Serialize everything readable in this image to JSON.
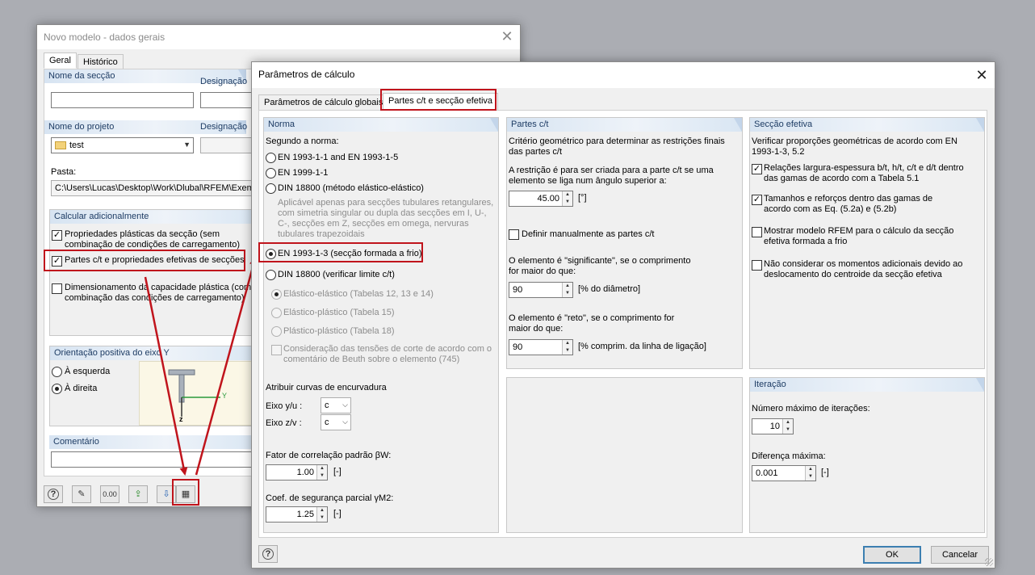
{
  "back_window": {
    "title": "Novo modelo - dados gerais",
    "tabs": [
      "Geral",
      "Histórico"
    ],
    "section_name_label": "Nome da secção",
    "designation_label": "Designação",
    "section_name_value": "",
    "project_name_label": "Nome do projeto",
    "project_designation_label": "Designação",
    "project_value": "test",
    "folder_label": "Pasta:",
    "folder_value": "C:\\Users\\Lucas\\Desktop\\Work\\Dlubal\\RFEM\\Exemp",
    "calc_group_title": "Calcular adicionalmente",
    "calc_options": [
      {
        "label": "Propriedades plásticas da secção (sem combinação de condições de carregamento)",
        "checked": true
      },
      {
        "label": "Partes c/t e propriedades efetivas de secções",
        "checked": true
      },
      {
        "label": "Dimensionamento da capacidade plástica (com combinação das condições de carregamento)",
        "checked": false
      }
    ],
    "axis_group_title": "Orientação positiva do eixo Y",
    "axis_options": [
      {
        "label": "À esquerda",
        "selected": false
      },
      {
        "label": "À direita",
        "selected": true
      }
    ],
    "axis_y": "Y",
    "axis_z": "z",
    "comment_label": "Comentário",
    "toolbar_icons": [
      "help-icon",
      "edit-icon",
      "units-icon",
      "export-icon",
      "import-icon",
      "settings-icon"
    ],
    "units_text": "0.00"
  },
  "dialog": {
    "title": "Parâmetros de cálculo",
    "tabs": [
      "Parâmetros de cálculo globais",
      "Partes c/t e secção efetiva"
    ],
    "norma": {
      "title": "Norma",
      "according_label": "Segundo a norma:",
      "options": [
        {
          "label": "EN 1993-1-1 and EN 1993-1-5",
          "selected": false
        },
        {
          "label": "EN 1999-1-1",
          "selected": false
        },
        {
          "label": "DIN 18800 (método elástico-elástico)",
          "selected": false
        },
        {
          "label": "EN 1993-1-3 (secção formada a frio)",
          "selected": true
        },
        {
          "label": "DIN 18800 (verificar limite c/t)",
          "selected": false
        }
      ],
      "din_note": "Aplicável apenas para secções tubulares retangulares, com simetria singular ou dupla das secções em I, U-, C-, secções em Z, secções em omega, nervuras tubulares trapezoidais",
      "sub_options": [
        "Elástico-elástico (Tabelas 12, 13 e 14)",
        "Elástico-plástico  (Tabela 15)",
        "Plástico-plástico  (Tabela 18)"
      ],
      "shear_label": "Consideração das tensões de corte de acordo com o comentário de Beuth sobre o elemento (745)",
      "curves_label": "Atribuir curvas de encurvadura",
      "axis_yu_label": "Eixo y/u :",
      "axis_yu_value": "c",
      "axis_zv_label": "Eixo z/v :",
      "axis_zv_value": "c",
      "corr_label": "Fator de correlação padrão βW:",
      "corr_value": "1.00",
      "corr_unit": "[-]",
      "gamma_label": "Coef. de segurança parcial γM2:",
      "gamma_value": "1.25",
      "gamma_unit": "[-]"
    },
    "ct": {
      "title": "Partes c/t",
      "desc": "Critério geométrico para determinar as restrições finais das partes c/t",
      "restriction_label": "A restrição é para ser criada para a parte c/t se uma elemento se liga num ângulo superior a:",
      "angle_value": "45.00",
      "angle_unit": "[°]",
      "manual_label": "Definir manualmente as partes c/t",
      "significant_label": "O elemento é \"significante\", se o comprimento for maior do que:",
      "significant_value": "90",
      "significant_unit": "[% do diâmetro]",
      "straight_label": "O elemento é \"reto\", se o comprimento for maior do que:",
      "straight_value": "90",
      "straight_unit": "[% comprim. da linha de ligação]"
    },
    "effective": {
      "title": "Secção efetiva",
      "desc": "Verificar proporções geométricas de acordo com EN 1993-1-3, 5.2",
      "options": [
        {
          "label": "Relações largura-espessura b/t, h/t, c/t e d/t dentro das gamas de acordo com a Tabela 5.1",
          "checked": true
        },
        {
          "label": "Tamanhos e reforços dentro das gamas de acordo com as Eq. (5.2a) e (5.2b)",
          "checked": true
        },
        {
          "label": "Mostrar modelo RFEM para o cálculo da secção efetiva formada a frio",
          "checked": false
        },
        {
          "label": "Não considerar os momentos adicionais devido ao deslocamento do centroide da secção efetiva",
          "checked": false
        }
      ]
    },
    "iteration": {
      "title": "Iteração",
      "max_iter_label": "Número máximo de iterações:",
      "max_iter_value": "10",
      "max_diff_label": "Diferença máxima:",
      "max_diff_value": "0.001",
      "max_diff_unit": "[-]"
    },
    "buttons": {
      "ok": "OK",
      "cancel": "Cancelar"
    }
  },
  "colors": {
    "highlight": "#c0141c",
    "group_header": "#1e3c64"
  }
}
